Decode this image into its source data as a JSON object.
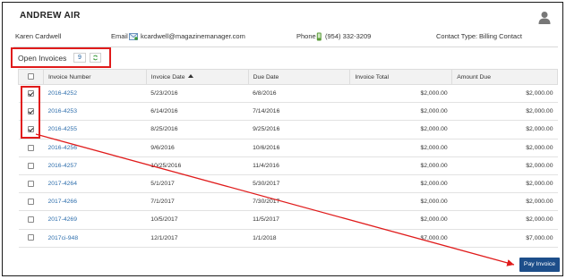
{
  "header": {
    "company_name": "ANDREW AIR",
    "user_icon": "person-icon"
  },
  "contact": {
    "name": "Karen Cardwell",
    "email_label": "Email",
    "email_icon": "mail-icon",
    "email": "kcardwell@magazinemanager.com",
    "phone_label": "Phone",
    "phone_icon": "phone-icon",
    "phone": "(954) 332-3209",
    "contact_type_label": "Contact Type:",
    "contact_type": "Billing Contact"
  },
  "open_invoices": {
    "label": "Open Invoices",
    "count": "9",
    "refresh_icon": "refresh-icon"
  },
  "table": {
    "columns": [
      "Invoice Number",
      "Invoice Date",
      "Due Date",
      "Invoice Total",
      "Amount Due"
    ],
    "sorted_column": "Invoice Date",
    "rows": [
      {
        "checked": true,
        "invoice_number": "2016-4252",
        "invoice_date": "5/23/2016",
        "due_date": "6/8/2016",
        "invoice_total": "$2,000.00",
        "amount_due": "$2,000.00"
      },
      {
        "checked": true,
        "invoice_number": "2016-4253",
        "invoice_date": "6/14/2016",
        "due_date": "7/14/2016",
        "invoice_total": "$2,000.00",
        "amount_due": "$2,000.00"
      },
      {
        "checked": true,
        "invoice_number": "2016-4255",
        "invoice_date": "8/25/2016",
        "due_date": "9/25/2016",
        "invoice_total": "$2,000.00",
        "amount_due": "$2,000.00"
      },
      {
        "checked": false,
        "invoice_number": "2016-4256",
        "invoice_date": "9/6/2016",
        "due_date": "10/6/2016",
        "invoice_total": "$2,000.00",
        "amount_due": "$2,000.00"
      },
      {
        "checked": false,
        "invoice_number": "2016-4257",
        "invoice_date": "10/25/2016",
        "due_date": "11/4/2016",
        "invoice_total": "$2,000.00",
        "amount_due": "$2,000.00"
      },
      {
        "checked": false,
        "invoice_number": "2017-4264",
        "invoice_date": "5/1/2017",
        "due_date": "5/30/2017",
        "invoice_total": "$2,000.00",
        "amount_due": "$2,000.00"
      },
      {
        "checked": false,
        "invoice_number": "2017-4266",
        "invoice_date": "7/1/2017",
        "due_date": "7/30/2017",
        "invoice_total": "$2,000.00",
        "amount_due": "$2,000.00"
      },
      {
        "checked": false,
        "invoice_number": "2017-4269",
        "invoice_date": "10/5/2017",
        "due_date": "11/5/2017",
        "invoice_total": "$2,000.00",
        "amount_due": "$2,000.00"
      },
      {
        "checked": false,
        "invoice_number": "2017ci-948",
        "invoice_date": "12/1/2017",
        "due_date": "1/1/2018",
        "invoice_total": "$7,000.00",
        "amount_due": "$7,000.00"
      }
    ]
  },
  "actions": {
    "pay_label": "Pay Invoice"
  },
  "colors": {
    "highlight_red": "#e01b1b",
    "link_blue": "#2f6fad",
    "button_blue": "#1d4e8a"
  }
}
